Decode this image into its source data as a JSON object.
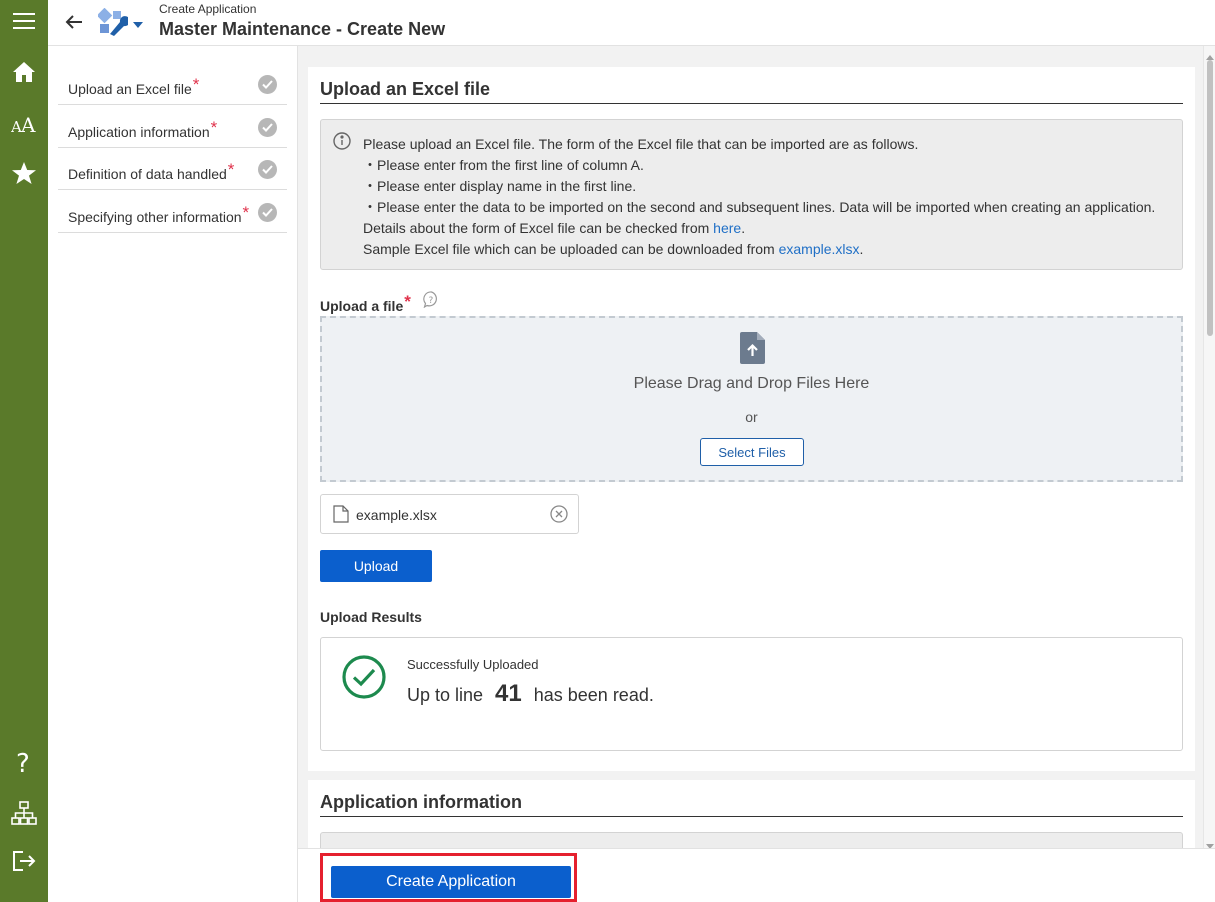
{
  "rail": {
    "icons": [
      "menu-icon",
      "home-icon",
      "font-size-icon",
      "favorite-star-icon",
      "help-icon",
      "sitemap-icon",
      "logout-icon"
    ]
  },
  "header": {
    "breadcrumb": "Create Application",
    "title": "Master Maintenance - Create New"
  },
  "steps": [
    {
      "label": "Upload an Excel file",
      "required": "*"
    },
    {
      "label": "Application information",
      "required": "*"
    },
    {
      "label": "Definition of data handled",
      "required": "*"
    },
    {
      "label": "Specifying other information",
      "required": "*"
    }
  ],
  "upload_section": {
    "title": "Upload an Excel file",
    "info": {
      "line1": "Please upload an Excel file. The form of the Excel file that can be imported are as follows.",
      "line2": "・Please enter from the first line of column A.",
      "line3": "・Please enter display name in the first line.",
      "line4": "・Please enter the data to be imported on the second and subsequent lines. Data will be imported when creating an application.",
      "line5_prefix": "Details about the form of Excel file can be checked from ",
      "line5_link": "here",
      "line5_suffix": ".",
      "line6_prefix": "Sample Excel file which can be uploaded can be downloaded from ",
      "line6_link": "example.xlsx",
      "line6_suffix": "."
    },
    "file_label": "Upload a file",
    "required": "*",
    "dropzone_text": "Please Drag and Drop Files Here",
    "or_text": "or",
    "select_button": "Select Files",
    "selected_file": "example.xlsx",
    "upload_button": "Upload",
    "results_label": "Upload Results",
    "result_status": "Successfully Uploaded",
    "result_prefix": "Up to line",
    "result_line_number": "41",
    "result_suffix": "has been read."
  },
  "app_info_section": {
    "title": "Application information"
  },
  "footer": {
    "create_button": "Create Application"
  },
  "colors": {
    "rail": "#5a7a2a",
    "primary_button": "#0b5fcd",
    "required": "#e0324b",
    "success": "#1d8a4e",
    "highlight": "#e5202e",
    "link": "#1f6fc6"
  }
}
